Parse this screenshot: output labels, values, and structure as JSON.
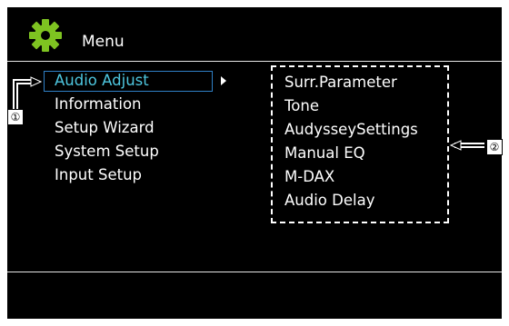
{
  "header": {
    "icon": "gear-icon",
    "title": "Menu"
  },
  "main_menu": {
    "items": [
      {
        "label": "Audio Adjust",
        "selected": true
      },
      {
        "label": "Information",
        "selected": false
      },
      {
        "label": "Setup Wizard",
        "selected": false
      },
      {
        "label": "System Setup",
        "selected": false
      },
      {
        "label": "Input Setup",
        "selected": false
      }
    ]
  },
  "submenu": {
    "items": [
      {
        "label": "Surr.Parameter"
      },
      {
        "label": "Tone"
      },
      {
        "label": "AudysseySettings"
      },
      {
        "label": "Manual EQ"
      },
      {
        "label": "M-DAX"
      },
      {
        "label": "Audio Delay"
      }
    ]
  },
  "callouts": {
    "one": "①",
    "two": "②"
  },
  "colors": {
    "screen_bg": "#000000",
    "text": "#ffffff",
    "selected_text": "#4ec6df",
    "selection_border": "#2f7fc6",
    "gear": "#7ec321"
  }
}
